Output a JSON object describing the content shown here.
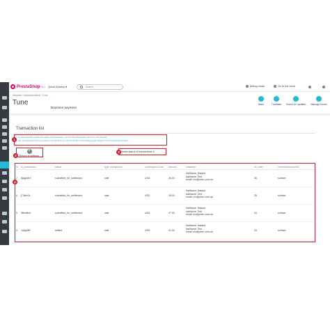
{
  "colors": {
    "accent": "#25b9d7",
    "brand": "#df0067",
    "highlight": "#cc1f2f",
    "sidebar": "#363a41"
  },
  "topbar": {
    "logo_pre": "Presta",
    "logo_post": "Shop",
    "version": "1.7.6.x",
    "quick_access": "Quick Access ▾",
    "search_placeholder": "Search",
    "debug_mode": "debug mode",
    "goto_store": "Go to the store"
  },
  "header": {
    "breadcrumb": "Modules  /  braintreeofficial  /  Tune",
    "title": "Tune",
    "module_name": "Braintree payment",
    "actions": [
      {
        "icon": "back-icon",
        "label": "Back"
      },
      {
        "icon": "translate-icon",
        "label": "Translate"
      },
      {
        "icon": "check-update-icon",
        "label": "Check for updates"
      },
      {
        "icon": "manage-hooks-icon",
        "label": "Manage hooks"
      }
    ]
  },
  "panel": {
    "title": "Transaction list",
    "info_line1": "To automatically update the status of transactions, set the Task Scheduler (Cron) to visit this link:",
    "info_link": "http://prestashop176.ps.prestatec.com/admin/index.php?controller=AdminModules&configure=braintreeofficial&update=",
    "return_label": "Return to settings",
    "update_label": "Update status of transactions ↻",
    "badges": [
      "1",
      "2",
      "3",
      "4"
    ]
  },
  "table": {
    "headers": [
      "id",
      "id_transaction",
      "status",
      "type_transaction",
      "currencyIsoCode",
      "amount",
      "customer",
      "id_order",
      "merchantAccountId"
    ],
    "rows": [
      {
        "id": "7",
        "id_transaction": "8jwgb8n7",
        "status": "submitted_for_settlement",
        "type": "sale",
        "currency": "USD",
        "amount": "26.00",
        "first": "firstName: Natalia",
        "last": "lastName: Test",
        "email": "email: nic@prtec.com.ua",
        "id_order": "36",
        "merchant": "surface"
      },
      {
        "id": "6",
        "id_transaction": "j73shr0b",
        "status": "submitted_for_settlement",
        "type": "sale",
        "currency": "USD",
        "amount": "18.00",
        "first": "firstName: Natalia",
        "last": "lastName: Test",
        "email": "email: nic@prtec.com.ua",
        "id_order": "35",
        "merchant": "surface"
      },
      {
        "id": "5",
        "id_transaction": "3fkha8ok",
        "status": "submitted_for_settlement",
        "type": "sale",
        "currency": "USD",
        "amount": "47.00",
        "first": "firstName: Natalia",
        "last": "lastName: Test",
        "email": "email: nic@prtec.com.ua",
        "id_order": "34",
        "merchant": "surface"
      },
      {
        "id": "4",
        "id_transaction": "1qbjq3f5",
        "status": "settled",
        "type": "sale",
        "currency": "USD",
        "amount": "31.00",
        "first": "firstName: Natalia",
        "last": "lastName: Test",
        "email": "email: nic@prtec.com.ua",
        "id_order": "33",
        "merchant": "surface"
      }
    ]
  }
}
